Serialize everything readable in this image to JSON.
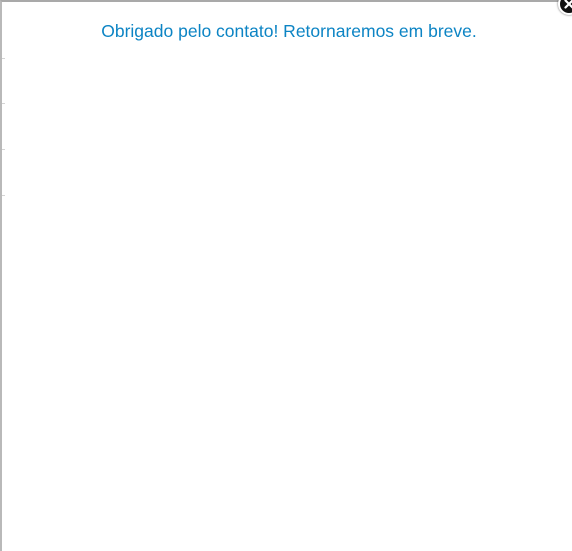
{
  "modal": {
    "message": "Obrigado pelo contato! Retornaremos em breve.",
    "close_icon": "close-icon",
    "colors": {
      "message_text": "#0c84c4",
      "close_background": "#111111",
      "background": "#ffffff"
    }
  }
}
